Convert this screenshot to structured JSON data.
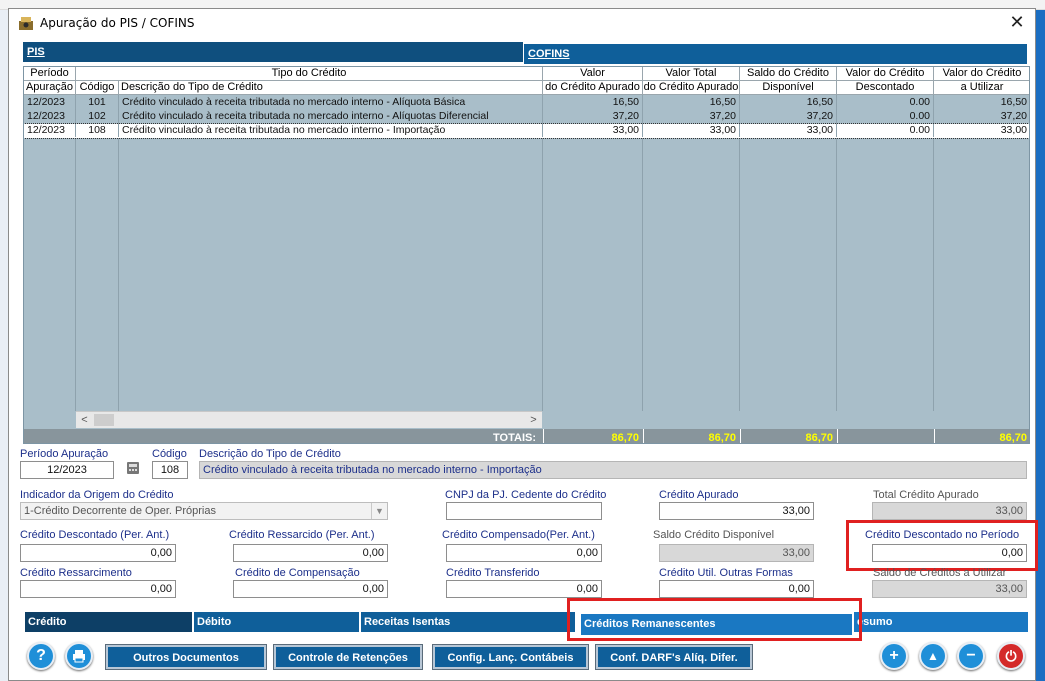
{
  "window": {
    "title": "Apuração do PIS / COFINS",
    "close": "✕"
  },
  "tabs_top": [
    {
      "label": "PIS"
    },
    {
      "label": "COFINS"
    }
  ],
  "grid": {
    "group_headers": [
      "Período",
      "Tipo do Crédito",
      "Valor",
      "Valor Total",
      "Saldo do Crédito",
      "Valor do Crédito",
      "Valor do Crédito"
    ],
    "sub_headers": [
      "Apuração",
      "Código",
      "Descrição do Tipo de Crédito",
      "do Crédito Apurado",
      "do Crédito Apurado",
      "Disponível",
      "Descontado",
      "a Utilizar"
    ],
    "rows": [
      {
        "periodo": "12/2023",
        "codigo": "101",
        "descricao": "Crédito vinculado à receita tributada no mercado interno - Alíquota Básica",
        "valor": "16,50",
        "valor_total": "16,50",
        "saldo": "16,50",
        "descontado": "0.00",
        "utilizar": "16,50"
      },
      {
        "periodo": "12/2023",
        "codigo": "102",
        "descricao": "Crédito vinculado à receita tributada no mercado interno - Alíquotas Diferencial",
        "valor": "37,20",
        "valor_total": "37,20",
        "saldo": "37,20",
        "descontado": "0.00",
        "utilizar": "37,20"
      },
      {
        "periodo": "12/2023",
        "codigo": "108",
        "descricao": "Crédito vinculado à receita tributada no mercado interno - Importação",
        "valor": "33,00",
        "valor_total": "33,00",
        "saldo": "33,00",
        "descontado": "0.00",
        "utilizar": "33,00"
      }
    ],
    "totals": {
      "label": "TOTAIS:",
      "valor": "86,70",
      "valor_total": "86,70",
      "saldo": "86,70",
      "descontado": "",
      "utilizar": "86,70"
    },
    "scroll_left": "<",
    "scroll_right": ">"
  },
  "form": {
    "periodo_label": "Período Apuração",
    "periodo_value": "12/2023",
    "codigo_label": "Código",
    "codigo_value": "108",
    "descricao_label": "Descrição do Tipo de Crédito",
    "descricao_value": "Crédito vinculado à receita tributada no mercado interno - Importação",
    "origem_label": "Indicador da Origem do Crédito",
    "origem_value": "1-Crédito Decorrente de Oper. Próprias",
    "cnpj_label": "CNPJ da PJ. Cedente do Crédito",
    "cnpj_value": "",
    "apurado_label": "Crédito Apurado",
    "apurado_value": "33,00",
    "total_apurado_label": "Total Crédito Apurado",
    "total_apurado_value": "33,00",
    "descontado_ant_label": "Crédito Descontado (Per. Ant.)",
    "descontado_ant_value": "0,00",
    "ressarcido_ant_label": "Crédito Ressarcido (Per. Ant.)",
    "ressarcido_ant_value": "0,00",
    "compensado_ant_label": "Crédito Compensado(Per. Ant.)",
    "compensado_ant_value": "0,00",
    "saldo_disp_label": "Saldo Crédito Disponível",
    "saldo_disp_value": "33,00",
    "desc_periodo_label": "Crédito Descontado no Período",
    "desc_periodo_value": "0,00",
    "ressarcimento_label": "Crédito Ressarcimento",
    "ressarcimento_value": "0,00",
    "compensacao_label": "Crédito de Compensação",
    "compensacao_value": "0,00",
    "transferido_label": "Crédito Transferido",
    "transferido_value": "0,00",
    "outras_label": "Crédito Util. Outras Formas",
    "outras_value": "0,00",
    "saldo_utilizar_label": "Saldo de Créditos a Utilizar",
    "saldo_utilizar_value": "33,00"
  },
  "tabs_bottom": [
    {
      "label": "Crédito"
    },
    {
      "label": "Débito"
    },
    {
      "label": "Receitas Isentas"
    },
    {
      "label": "Créditos Remanescentes"
    },
    {
      "label": "esumo"
    }
  ],
  "buttons": {
    "outros": "Outros Documentos",
    "retencoes": "Controle de Retenções",
    "config_lanc": "Config. Lanç. Contábeis",
    "conf_darf": "Conf. DARF's Alíq. Difer."
  },
  "icons": {
    "help": "help-icon",
    "print": "print-icon",
    "add": "add-icon",
    "up": "up-icon",
    "remove": "remove-icon",
    "power": "power-icon"
  },
  "colors": {
    "tab_blue": "#0f5f9a",
    "grid_bg": "#a9bec9",
    "highlight_red": "#e02020",
    "totals_yellow": "#ffff00"
  }
}
